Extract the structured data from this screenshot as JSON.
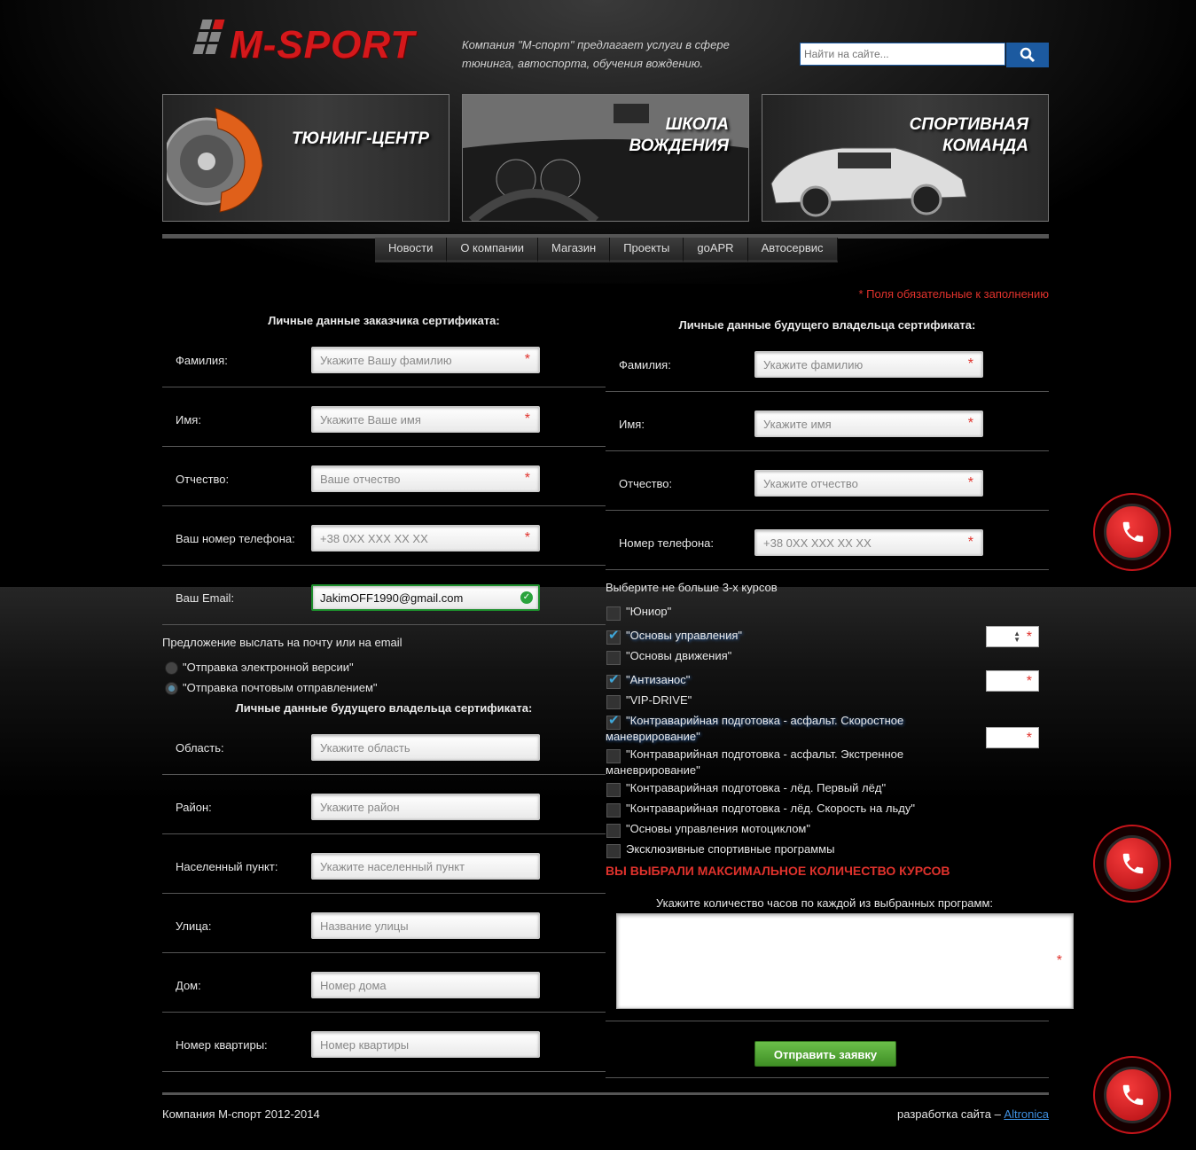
{
  "header": {
    "logo": "M-SPORT",
    "tagline": "Компания \"М-спорт\" предлагает услуги в сфере тюнинга, автоспорта, обучения вождению.",
    "search_placeholder": "Найти на сайте..."
  },
  "banners": [
    {
      "title_line1": "ТЮНИНГ-ЦЕНТР",
      "title_line2": ""
    },
    {
      "title_line1": "ШКОЛА",
      "title_line2": "ВОЖДЕНИЯ"
    },
    {
      "title_line1": "СПОРТИВНАЯ",
      "title_line2": "КОМАНДА"
    }
  ],
  "nav": [
    "Новости",
    "О компании",
    "Магазин",
    "Проекты",
    "goAPR",
    "Автосервис"
  ],
  "required_note": "* Поля обязательные к заполнению",
  "customer": {
    "heading": "Личные данные заказчика сертификата:",
    "fields": [
      {
        "label": "Фамилия:",
        "placeholder": "Укажите Вашу фамилию"
      },
      {
        "label": "Имя:",
        "placeholder": "Укажите Ваше имя"
      },
      {
        "label": "Отчество:",
        "placeholder": "Ваше отчество"
      },
      {
        "label": "Ваш номер телефона:",
        "placeholder": "+38  0XX XXX XX XX"
      },
      {
        "label": "Ваш Email:",
        "value": "JakimOFF1990@gmail.com"
      }
    ]
  },
  "delivery": {
    "prompt": "Предложение выслать на почту или на email",
    "options": [
      {
        "label": "\"Отправка электронной версии\"",
        "selected": false
      },
      {
        "label": "\"Отправка почтовым отправлением\"",
        "selected": true
      }
    ]
  },
  "address": {
    "heading": "Личные данные будущего владельца сертификата:",
    "fields": [
      {
        "label": "Область:",
        "placeholder": "Укажите область"
      },
      {
        "label": "Район:",
        "placeholder": "Укажите район"
      },
      {
        "label": "Населенный пункт:",
        "placeholder": "Укажите населенный пункт"
      },
      {
        "label": "Улица:",
        "placeholder": "Название улицы"
      },
      {
        "label": "Дом:",
        "placeholder": "Номер дома"
      },
      {
        "label": "Номер квартиры:",
        "placeholder": "Номер квартиры"
      }
    ]
  },
  "owner": {
    "heading": "Личные данные будущего владельца сертификата:",
    "fields": [
      {
        "label": "Фамилия:",
        "placeholder": "Укажите фамилию"
      },
      {
        "label": "Имя:",
        "placeholder": "Укажите имя"
      },
      {
        "label": "Отчество:",
        "placeholder": "Укажите отчество"
      },
      {
        "label": "Номер телефона:",
        "placeholder": "+38 0XX XXX XX XX"
      }
    ]
  },
  "courses": {
    "prompt": "Выберите не больше 3-х курсов",
    "items": [
      {
        "label": "\"Юниор\"",
        "checked": false
      },
      {
        "label": "\"Основы управления\"",
        "checked": true
      },
      {
        "label": "\"Основы движения\"",
        "checked": false
      },
      {
        "label": "\"Антизанос\"",
        "checked": true
      },
      {
        "label": "\"VIP-DRIVE\"",
        "checked": false
      },
      {
        "label_line1": "\"Контраварийная подготовка - асфальт. Скоростное",
        "label_line2": "маневрирование\"",
        "checked": true
      },
      {
        "label_line1": "\"Контраварийная подготовка - асфальт. Экстренное",
        "label_line2": "маневрирование\"",
        "checked": false
      },
      {
        "label": "\"Контраварийная подготовка - лёд. Первый лёд\"",
        "checked": false
      },
      {
        "label": "\"Контраварийная подготовка - лёд. Скорость на льду\"",
        "checked": false
      },
      {
        "label": "\"Основы управления мотоциклом\"",
        "checked": false
      },
      {
        "label": "Эксклюзивные спортивные программы",
        "checked": false
      }
    ],
    "max_message": "ВЫ ВЫБРАЛИ МАКСИМАЛЬНОЕ КОЛИЧЕСТВО КУРСОВ",
    "hours_prompt": "Укажите количество часов по каждой из выбранных программ:"
  },
  "submit_label": "Отправить заявку",
  "footer": {
    "copyright": "Компания М-спорт 2012-2014",
    "dev_text": "разработка сайта – ",
    "dev_link": "Altronica"
  },
  "colors": {
    "accent_red": "#e0322c",
    "submit_green": "#4fa232",
    "search_blue": "#1c5aa0"
  },
  "icons": [
    "search-icon",
    "phone-icon"
  ]
}
